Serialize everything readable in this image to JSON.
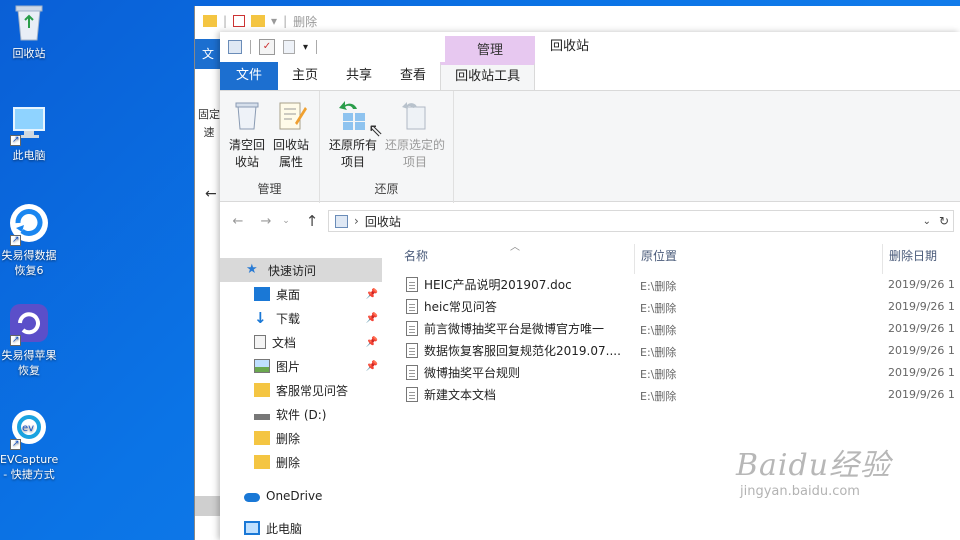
{
  "desktop": {
    "icons": [
      {
        "label": "回收站",
        "icon": "recycle-bin-icon"
      },
      {
        "label": "此电脑",
        "icon": "computer-icon"
      },
      {
        "label": "失易得数据恢复6",
        "icon": "recovery-app-icon"
      },
      {
        "label": "失易得苹果恢复",
        "icon": "apple-recovery-app-icon"
      },
      {
        "label": "EVCapture - 快捷方式",
        "icon": "evcapture-icon"
      }
    ]
  },
  "back_window": {
    "title": "删除",
    "tab": "文",
    "side_text": "固定速",
    "back_arrow": "←"
  },
  "window": {
    "context_group": "管理",
    "title": "回收站",
    "tabs": [
      "文件",
      "主页",
      "共享",
      "查看",
      "回收站工具"
    ],
    "ribbon": {
      "groups": [
        {
          "label": "管理",
          "buttons": [
            {
              "label": "清空回收站",
              "icon": "empty-recycle-bin-icon"
            },
            {
              "label": "回收站属性",
              "icon": "properties-icon"
            }
          ]
        },
        {
          "label": "还原",
          "buttons": [
            {
              "label": "还原所有项目",
              "icon": "restore-all-icon"
            },
            {
              "label": "还原选定的项目",
              "icon": "restore-selected-icon"
            }
          ]
        }
      ]
    },
    "address": {
      "path": "回收站",
      "separator": "›"
    },
    "nav_glyphs": {
      "back": "←",
      "forward": "→",
      "recent": "⌄",
      "up": "↑"
    },
    "navpane": [
      {
        "label": "快速访问",
        "icon": "star-icon",
        "pinned": false,
        "selected": true
      },
      {
        "label": "桌面",
        "icon": "desktop-folder-icon",
        "pinned": true
      },
      {
        "label": "下载",
        "icon": "download-icon",
        "pinned": true
      },
      {
        "label": "文档",
        "icon": "documents-icon",
        "pinned": true
      },
      {
        "label": "图片",
        "icon": "pictures-icon",
        "pinned": true
      },
      {
        "label": "客服常见问答",
        "icon": "folder-icon",
        "pinned": false
      },
      {
        "label": "软件 (D:)",
        "icon": "drive-icon",
        "pinned": false
      },
      {
        "label": "删除",
        "icon": "folder-icon",
        "pinned": false
      },
      {
        "label": "删除",
        "icon": "folder-icon",
        "pinned": false
      },
      {
        "label": "OneDrive",
        "icon": "onedrive-icon",
        "pinned": false
      },
      {
        "label": "此电脑",
        "icon": "computer-icon",
        "pinned": false
      }
    ],
    "columns": [
      "名称",
      "原位置",
      "删除日期"
    ],
    "files": [
      {
        "name": "HEIC产品说明201907.doc",
        "location": "E:\\删除",
        "date": "2019/9/26 1"
      },
      {
        "name": "heic常见问答",
        "location": "E:\\删除",
        "date": "2019/9/26 1"
      },
      {
        "name": "前言微博抽奖平台是微博官方唯一",
        "location": "E:\\删除",
        "date": "2019/9/26 1"
      },
      {
        "name": "数据恢复客服回复规范化2019.07....",
        "location": "E:\\删除",
        "date": "2019/9/26 1"
      },
      {
        "name": "微博抽奖平台规则",
        "location": "E:\\删除",
        "date": "2019/9/26 1"
      },
      {
        "name": "新建文本文档",
        "location": "E:\\删除",
        "date": "2019/9/26 1"
      }
    ]
  },
  "watermark": {
    "brand": "Baidu经验",
    "url": "jingyan.baidu.com"
  },
  "colors": {
    "accent": "#1c6fd0",
    "context_tab": "#e7c8f0",
    "desktop": "#0b74e6"
  }
}
